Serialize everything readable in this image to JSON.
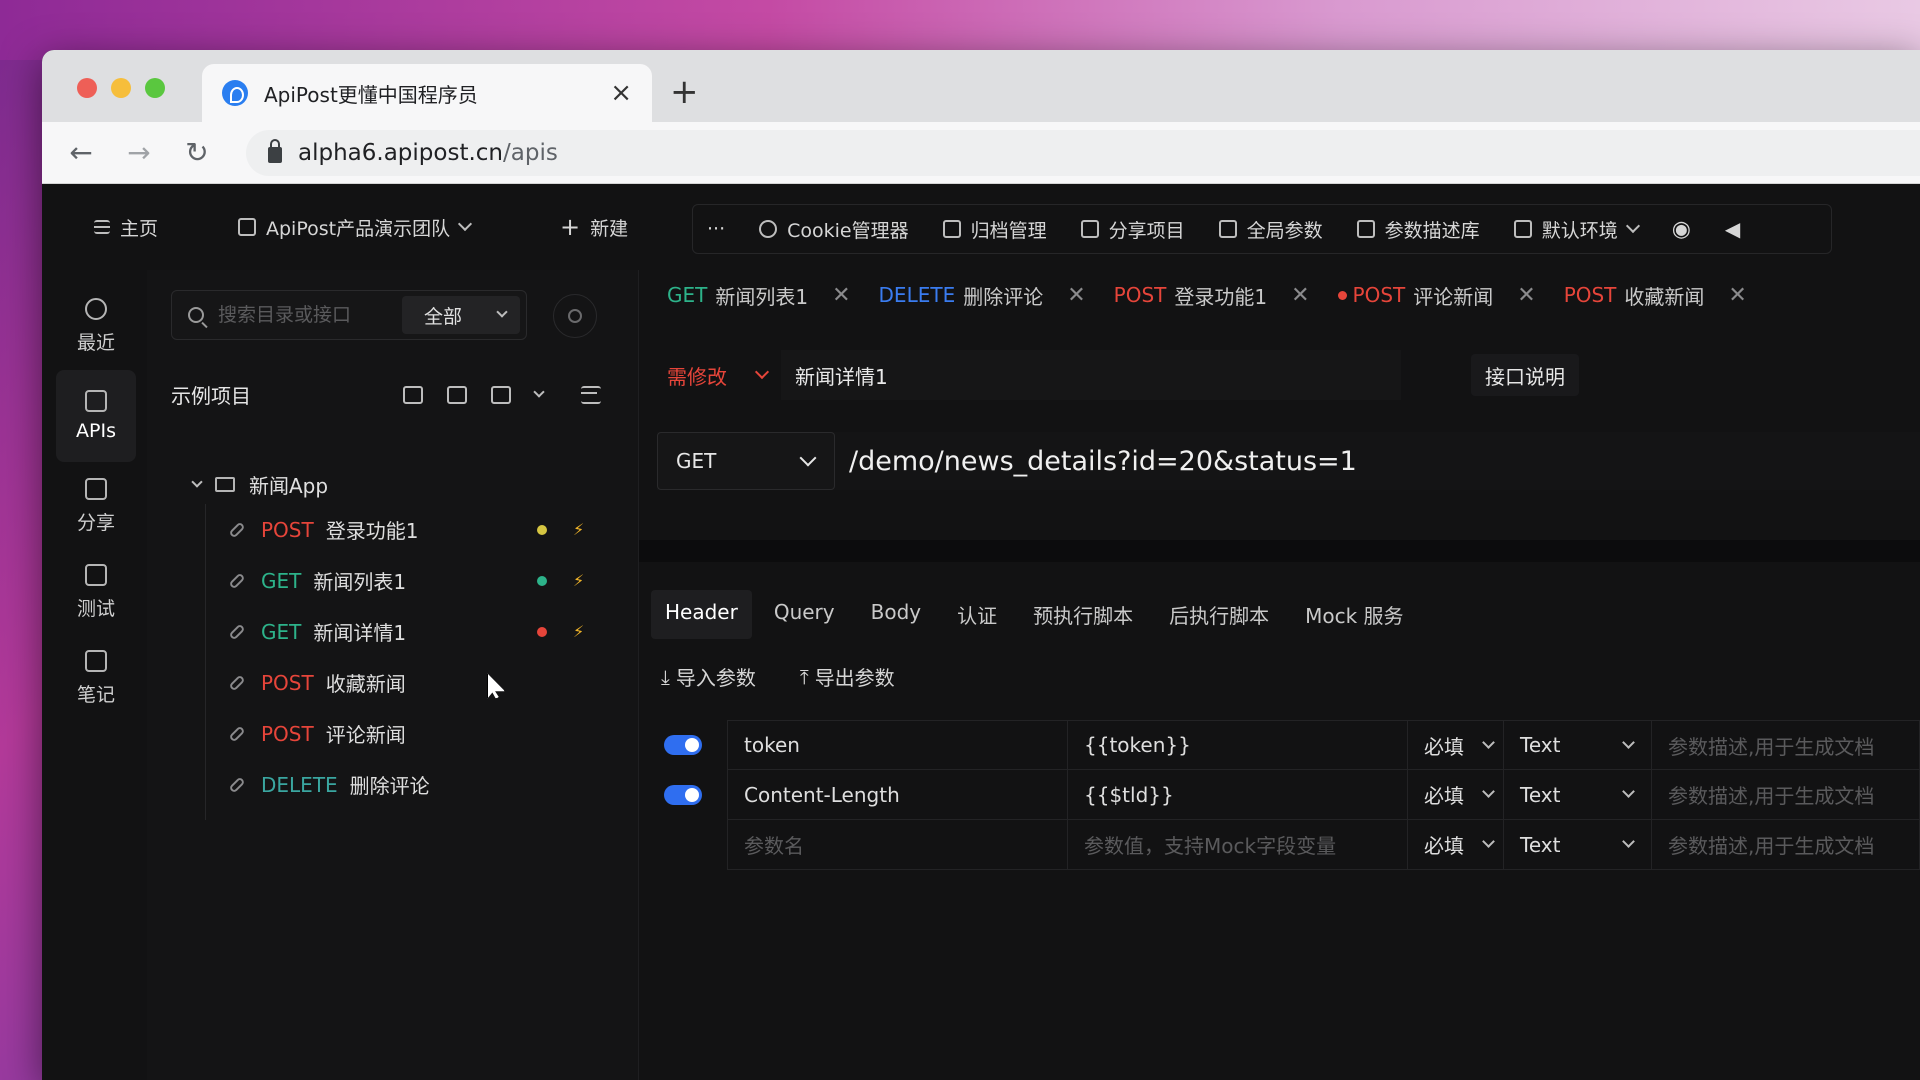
{
  "browser": {
    "tab_title": "ApiPost更懂中国程序员",
    "url_host": "alpha6.apipost.cn",
    "url_path": "/apis"
  },
  "topnav": {
    "home": "主页",
    "team": "ApiPost产品演示团队",
    "new": "新建",
    "more": "···",
    "cookie": "Cookie管理器",
    "archive": "归档管理",
    "share": "分享项目",
    "global": "全局参数",
    "params_lib": "参数描述库",
    "env": "默认环境"
  },
  "rail": {
    "recent": "最近",
    "apis": "APIs",
    "share": "分享",
    "test": "测试",
    "notes": "笔记"
  },
  "tree": {
    "search_placeholder": "搜索目录或接口",
    "scope": "全部",
    "project": "示例项目",
    "folder": "新闻App",
    "apis": [
      {
        "method": "POST",
        "name": "登录功能1",
        "dot": "#d6c642"
      },
      {
        "method": "GET",
        "name": "新闻列表1",
        "dot": "#2db38a"
      },
      {
        "method": "GET",
        "name": "新闻详情1",
        "dot": "#e6453a"
      },
      {
        "method": "POST",
        "name": "收藏新闻"
      },
      {
        "method": "POST",
        "name": "评论新闻"
      },
      {
        "method": "DELETE",
        "name": "删除评论"
      }
    ]
  },
  "tabs": [
    {
      "method": "GET",
      "name": "新闻列表1"
    },
    {
      "method": "DELETE",
      "name": "删除评论"
    },
    {
      "method": "POST",
      "name": "登录功能1"
    },
    {
      "method": "POST",
      "name": "评论新闻"
    },
    {
      "method": "POST",
      "name": "收藏新闻"
    }
  ],
  "request": {
    "status": "需修改",
    "name": "新闻详情1",
    "doc_button": "接口说明",
    "method": "GET",
    "url": "/demo/news_details?id=20&status=1"
  },
  "subtabs": [
    "Header",
    "Query",
    "Body",
    "认证",
    "预执行脚本",
    "后执行脚本",
    "Mock 服务"
  ],
  "actions": {
    "import": "导入参数",
    "export": "导出参数"
  },
  "headers": [
    {
      "key": "token",
      "value": "{{token}}",
      "required": "必填",
      "type": "Text",
      "desc_placeholder": "参数描述,用于生成文档"
    },
    {
      "key": "Content-Length",
      "value": "{{$tld}}",
      "required": "必填",
      "type": "Text",
      "desc_placeholder": "参数描述,用于生成文档"
    }
  ],
  "new_row": {
    "key_placeholder": "参数名",
    "value_placeholder": "参数值，支持Mock字段变量",
    "required": "必填",
    "type": "Text",
    "desc_placeholder": "参数描述,用于生成文档"
  },
  "colors": {
    "post": "#e6453a",
    "get": "#2db38a",
    "delete": "#3a7cf0",
    "accent": "#2f6ef0"
  }
}
